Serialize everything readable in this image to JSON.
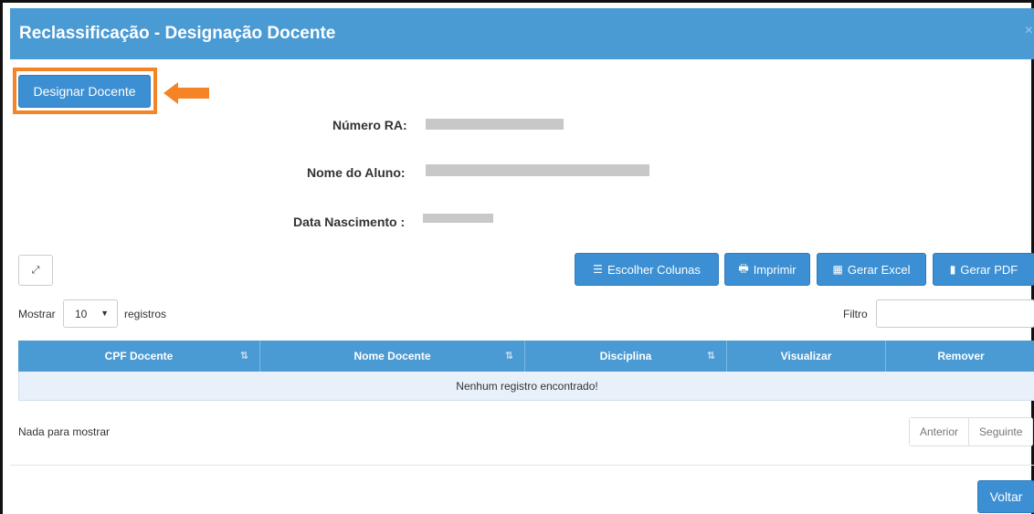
{
  "modal": {
    "title": "Reclassificação - Designação Docente",
    "close": "×"
  },
  "actions": {
    "designar_label": "Designar Docente"
  },
  "student_info": {
    "ra_label": "Número RA:",
    "nome_label": "Nome do Aluno:",
    "nascimento_label": "Data Nascimento :"
  },
  "toolbar": {
    "expand_icon": "⤢",
    "escolher_icon": "☰",
    "escolher_label": "Escolher Colunas",
    "imprimir_icon": "🖶",
    "imprimir_label": "Imprimir",
    "excel_icon": "▦",
    "excel_label": "Gerar Excel",
    "pdf_icon": "▮",
    "pdf_label": "Gerar PDF"
  },
  "table_controls": {
    "mostrar_label": "Mostrar",
    "page_size": "10",
    "registros_label": "registros",
    "filtro_label": "Filtro",
    "filtro_value": ""
  },
  "table": {
    "columns": [
      "CPF Docente",
      "Nome Docente",
      "Disciplina",
      "Visualizar",
      "Remover"
    ],
    "empty_message": "Nenhum registro encontrado!"
  },
  "footer": {
    "info": "Nada para mostrar",
    "prev_label": "Anterior",
    "next_label": "Seguinte",
    "voltar_label": "Voltar"
  },
  "colors": {
    "header_blue": "#4a9ad4",
    "button_blue": "#3b8fd2",
    "highlight_orange": "#f58426",
    "empty_row": "#e8f1fa"
  }
}
